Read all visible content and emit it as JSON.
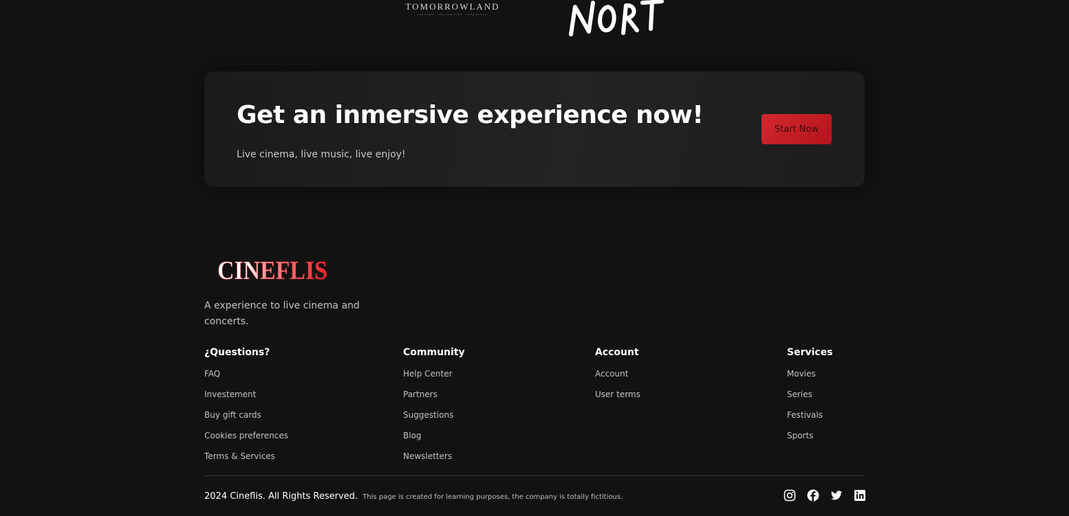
{
  "partners": {
    "tomorrowland": {
      "name": "TOMORROWLAND",
      "tagline": "live today · love tomorrow · unite forever"
    },
    "north": {
      "name": "NORTE"
    }
  },
  "cta": {
    "title": "Get an inmersive experience now!",
    "subtitle": "Live cinema, live music, live enjoy!",
    "button_label": "Start Now"
  },
  "brand": {
    "logo_text": "CINEFLIS",
    "tagline": "A experience to live cinema and concerts.",
    "colors": {
      "accent": "#c91f27",
      "background": "#121212",
      "card": "#212121"
    }
  },
  "footer": {
    "columns": [
      {
        "title": "¿Questions?",
        "links": [
          "FAQ",
          "Investement",
          "Buy gift cards",
          "Cookies preferences",
          "Terms & Services"
        ]
      },
      {
        "title": "Community",
        "links": [
          "Help Center",
          "Partners",
          "Suggestions",
          "Blog",
          "Newsletters"
        ]
      },
      {
        "title": "Account",
        "links": [
          "Account",
          "User terms"
        ]
      },
      {
        "title": "Services",
        "links": [
          "Movies",
          "Series",
          "Festivals",
          "Sports"
        ]
      }
    ],
    "copyright": "2024 Cineflis. All Rights Reserved.",
    "disclaimer": "This page is created for learning purposes, the company is totally fictitious.",
    "socials": [
      {
        "name": "instagram",
        "icon": "instagram-icon"
      },
      {
        "name": "facebook",
        "icon": "facebook-icon"
      },
      {
        "name": "twitter",
        "icon": "twitter-icon"
      },
      {
        "name": "linkedin",
        "icon": "linkedin-icon"
      }
    ]
  }
}
